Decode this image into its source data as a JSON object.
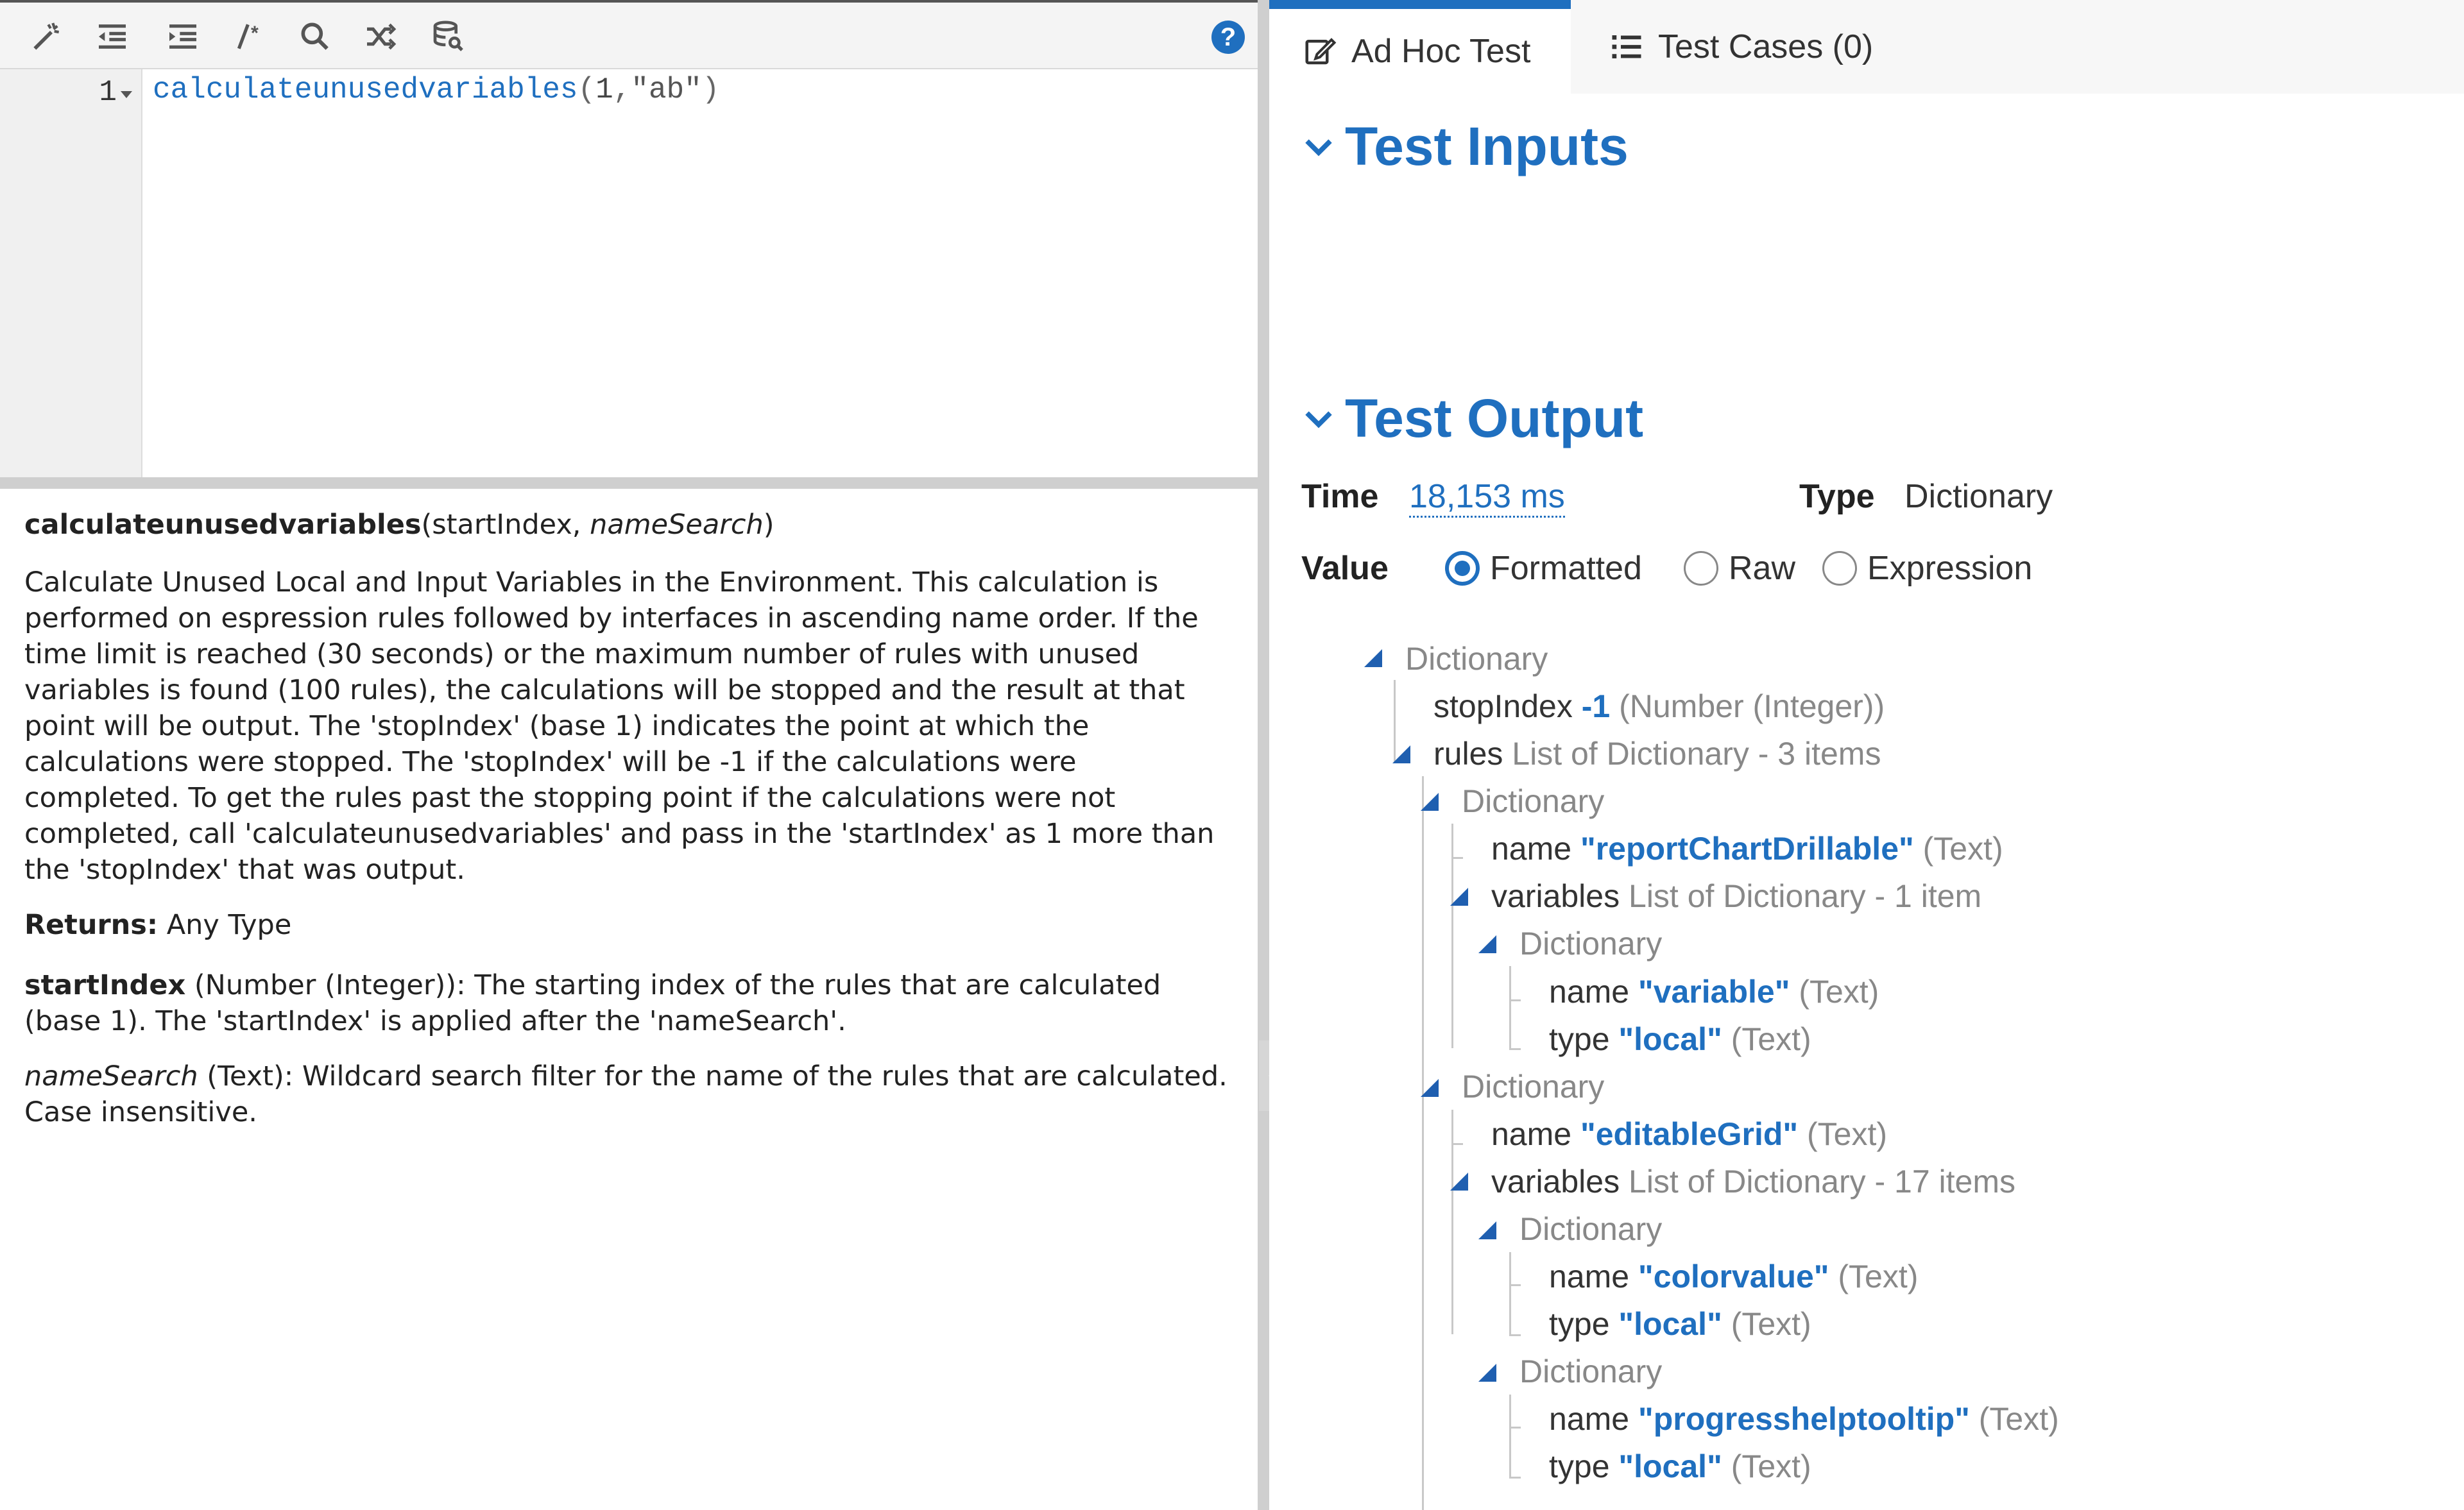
{
  "toolbar": {
    "icons": [
      "magic-wand-icon",
      "outdent-icon",
      "indent-icon",
      "comment-icon",
      "search-icon",
      "shuffle-icon",
      "database-search-icon"
    ],
    "help": "?"
  },
  "editor": {
    "line_number": "1",
    "code": {
      "fn": "calculateunusedvariables",
      "open": "(",
      "arg1": "1",
      "comma": ",",
      "arg2": "\"ab\"",
      "close": ")"
    }
  },
  "doc": {
    "signature": {
      "name": "calculateunusedvariables",
      "open": "(",
      "p1": "startIndex",
      "sep": ", ",
      "p2": "nameSearch",
      "close": ")"
    },
    "description": "Calculate Unused Local and Input Variables in the Environment. This calculation is performed on espression rules followed by interfaces in ascending name order. If the time limit is reached (30 seconds) or the maximum number of rules with unused variables is found (100 rules), the calculations will be stopped and the result at that point will be output. The 'stopIndex' (base 1) indicates the point at which the calculations were stopped. The 'stopIndex' will be -1 if the calculations were completed. To get the rules past the stopping point if the calculations were not completed, call 'calculateunusedvariables' and pass in the 'startIndex' as 1 more than the 'stopIndex' that was output.",
    "returns_label": "Returns:",
    "returns_value": " Any Type",
    "param1_name": "startIndex",
    "param1_desc": " (Number (Integer)): The starting index of the rules that are calculated (base 1). The 'startIndex' is applied after the 'nameSearch'.",
    "param2_name": "nameSearch",
    "param2_desc": " (Text): Wildcard search filter for the name of the rules that are calculated. Case insensitive."
  },
  "tabs": {
    "adhoc": "Ad Hoc Test",
    "cases": "Test Cases (0)"
  },
  "test_inputs": {
    "title": "Test Inputs"
  },
  "test_output": {
    "title": "Test Output",
    "time_label": "Time",
    "time_value": "18,153 ms",
    "type_label": "Type",
    "type_value": "Dictionary",
    "value_label": "Value",
    "radio_formatted": "Formatted",
    "radio_raw": "Raw",
    "radio_expression": "Expression",
    "selected": "Formatted"
  },
  "tree": {
    "root": "Dictionary",
    "stopIndex_key": "stopIndex",
    "stopIndex_val": "-1",
    "stopIndex_type": "(Number (Integer))",
    "rules_key": "rules",
    "rules_type": "List of Dictionary - 3 items",
    "d1": "Dictionary",
    "d1_name_key": "name",
    "d1_name_val": "\"reportChartDrillable\"",
    "d1_name_type": "(Text)",
    "d1_vars_key": "variables",
    "d1_vars_type": "List of Dictionary - 1 item",
    "d1v1": "Dictionary",
    "d1v1_name_key": "name",
    "d1v1_name_val": "\"variable\"",
    "d1v1_name_type": "(Text)",
    "d1v1_type_key": "type",
    "d1v1_type_val": "\"local\"",
    "d1v1_type_type": "(Text)",
    "d2": "Dictionary",
    "d2_name_key": "name",
    "d2_name_val": "\"editableGrid\"",
    "d2_name_type": "(Text)",
    "d2_vars_key": "variables",
    "d2_vars_type": "List of Dictionary - 17 items",
    "d2v1": "Dictionary",
    "d2v1_name_key": "name",
    "d2v1_name_val": "\"colorvalue\"",
    "d2v1_name_type": "(Text)",
    "d2v1_type_key": "type",
    "d2v1_type_val": "\"local\"",
    "d2v1_type_type": "(Text)",
    "d2v2": "Dictionary",
    "d2v2_name_key": "name",
    "d2v2_name_val": "\"progresshelptooltip\"",
    "d2v2_name_type": "(Text)",
    "d2v2_type_key": "type",
    "d2v2_type_val": "\"local\"",
    "d2v2_type_type": "(Text)"
  }
}
